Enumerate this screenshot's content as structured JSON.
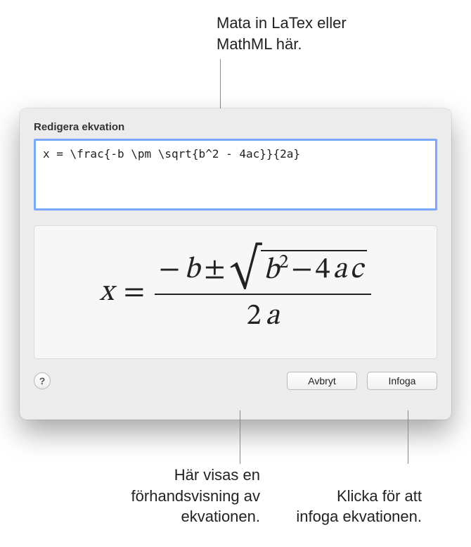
{
  "callouts": {
    "top": "Mata in LaTex eller MathML här.",
    "bottom_left": "Här visas en förhandsvisning av ekvationen.",
    "bottom_right": "Klicka för att infoga ekvationen."
  },
  "dialog": {
    "title": "Redigera ekvation",
    "input_value": "x = \\frac{-b \\pm \\sqrt{b^2 - 4ac}}{2a}",
    "help_label": "?",
    "buttons": {
      "cancel": "Avbryt",
      "insert": "Infoga"
    }
  },
  "equation": {
    "lhs_var": "x",
    "equals": "=",
    "minus": "−",
    "b": "b",
    "pm": "±",
    "exp": "2",
    "four": "4",
    "a": "a",
    "c": "c",
    "two": "2"
  }
}
